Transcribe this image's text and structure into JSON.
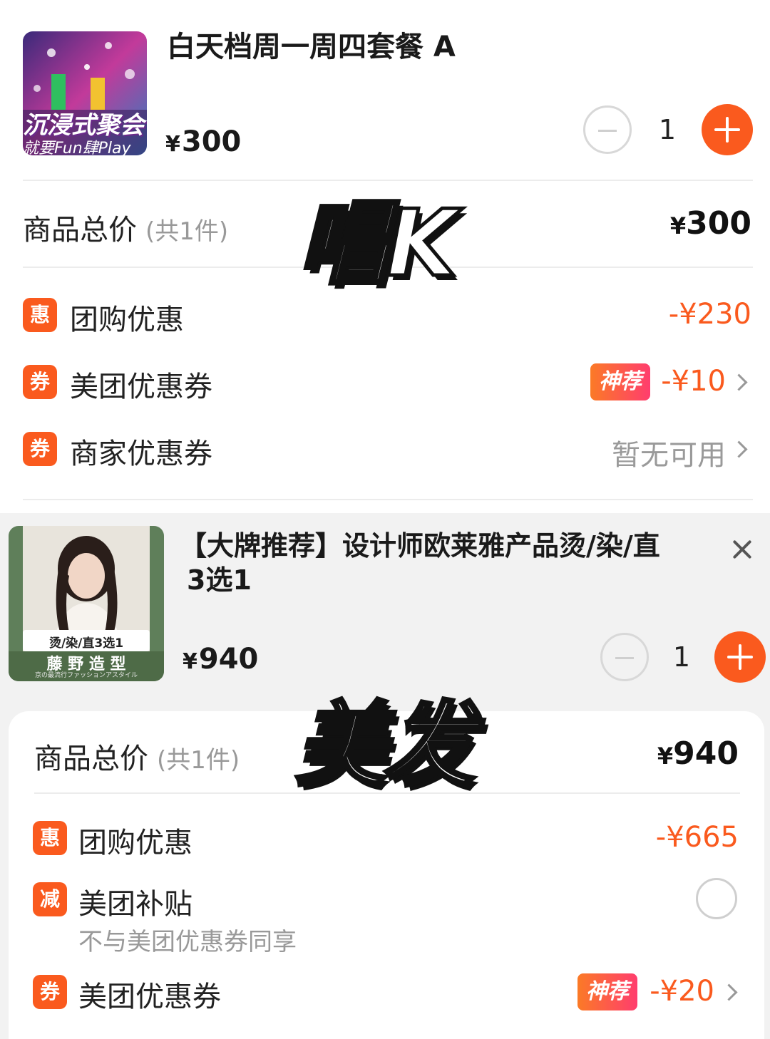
{
  "colors": {
    "accent": "#fa5a1e",
    "discount": "#fa5a1e",
    "rec_gradient_start": "#fb7a26",
    "rec_gradient_end": "#ff3d6e"
  },
  "product1": {
    "title": "白天档周一周四套餐 A",
    "image_text_1": "沉浸式聚会",
    "image_text_2": "就要Fun肆Play",
    "price_symbol": "¥",
    "price": "300",
    "quantity": "1"
  },
  "summary1": {
    "total_label": "商品总价",
    "total_count": "(共1件)",
    "total_symbol": "¥",
    "total_value": "300",
    "rows": [
      {
        "badge": "惠",
        "label": "团购优惠",
        "value": "-¥230"
      },
      {
        "badge": "券",
        "label": "美团优惠券",
        "tag": "神荐",
        "value": "-¥10"
      },
      {
        "badge": "券",
        "label": "商家优惠券",
        "value": "暂无可用"
      }
    ]
  },
  "overlay1": "唱K",
  "product2": {
    "title_line1": "【大牌推荐】设计师欧莱雅产品烫/染/直",
    "title_line2": "3选1",
    "image_text_1": "烫/染/直3选1",
    "image_text_2": "藤 野 造 型",
    "image_text_3": "京の最流行ファッションアスタイル",
    "price_symbol": "¥",
    "price": "940",
    "quantity": "1"
  },
  "summary2": {
    "total_label": "商品总价",
    "total_count": "(共1件)",
    "total_symbol": "¥",
    "total_value": "940",
    "rows": [
      {
        "badge": "惠",
        "label": "团购优惠",
        "value": "-¥665"
      },
      {
        "badge": "减",
        "label": "美团补贴",
        "sub": "不与美团优惠券同享"
      },
      {
        "badge": "券",
        "label": "美团优惠券",
        "tag": "神荐",
        "value": "-¥20"
      }
    ]
  },
  "overlay2": "美发"
}
